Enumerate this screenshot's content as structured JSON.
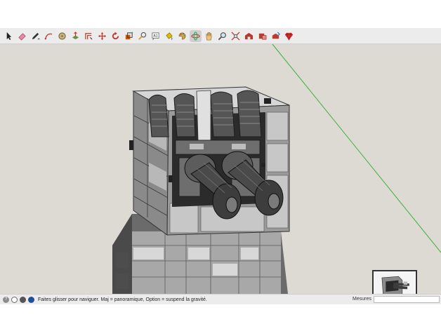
{
  "toolbar": {
    "tools": [
      {
        "name": "select-tool",
        "icon": "arrow-icon"
      },
      {
        "name": "eraser-tool",
        "icon": "eraser-icon"
      },
      {
        "name": "line-tool",
        "icon": "pencil-icon"
      },
      {
        "name": "arc-tool",
        "icon": "arc-icon"
      },
      {
        "name": "shape-tool",
        "icon": "circle-icon"
      },
      {
        "name": "push-pull-tool",
        "icon": "push-pull-icon"
      },
      {
        "name": "offset-tool",
        "icon": "offset-icon"
      },
      {
        "name": "move-tool",
        "icon": "move-icon"
      },
      {
        "name": "rotate-tool",
        "icon": "rotate-icon"
      },
      {
        "name": "scale-tool",
        "icon": "scale-icon"
      },
      {
        "name": "tape-measure-tool",
        "icon": "tape-icon"
      },
      {
        "name": "text-tool",
        "icon": "text-icon"
      },
      {
        "name": "paint-bucket-tool",
        "icon": "paint-bucket-icon"
      },
      {
        "name": "paint-tool",
        "icon": "paint-icon"
      },
      {
        "name": "orbit-tool",
        "icon": "orbit-icon"
      },
      {
        "name": "pan-tool",
        "icon": "hand-icon"
      },
      {
        "name": "zoom-tool",
        "icon": "magnifier-icon"
      },
      {
        "name": "zoom-extents-tool",
        "icon": "zoom-extents-icon"
      },
      {
        "name": "warehouse-tool",
        "icon": "warehouse-icon"
      },
      {
        "name": "extension-warehouse-tool",
        "icon": "extension-icon"
      },
      {
        "name": "share-model-tool",
        "icon": "share-icon"
      },
      {
        "name": "ruby-tool",
        "icon": "ruby-icon"
      }
    ],
    "text_tool_label": "A1",
    "active_tool": "orbit-tool"
  },
  "status": {
    "message": "Faites glisser pour naviguer. Maj = panoramique, Option =  suspend la gravité.",
    "measurements_label": "Mesures",
    "measurements_value": ""
  },
  "colors": {
    "viewport_bg": "#dcdad2",
    "axis_green": "#3fae3f",
    "toolbar_bg": "#ececec"
  }
}
